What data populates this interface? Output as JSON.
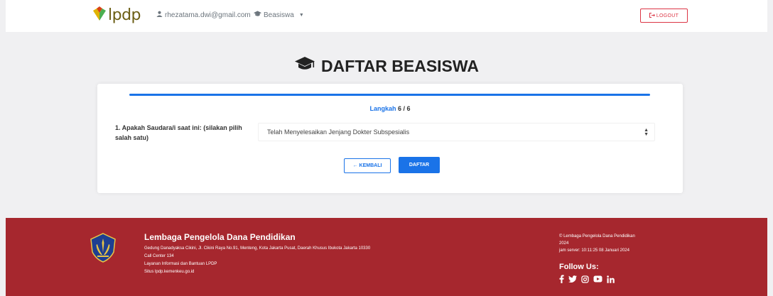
{
  "header": {
    "brand": "lpdp",
    "user_email": "rhezatama.dwi@gmail.com",
    "beasiswa_menu": "Beasiswa",
    "logout_label": "LOGOUT"
  },
  "page": {
    "title": "DAFTAR BEASISWA"
  },
  "form": {
    "step_word": "Langkah",
    "step_value": "6 / 6",
    "question_label": "1. Apakah Saudara/i saat ini: (silakan pilih salah satu)",
    "question_selected": "Telah Menyelesaikan Jenjang Dokter Subspesialis",
    "back_label": "← KEMBALI",
    "submit_label": "DAFTAR"
  },
  "footer": {
    "org_name": "Lembaga Pengelola Dana Pendidikan",
    "address": "Gedung Danadyaksa Cikini, Jl. Cikini Raya No.91, Menteng, Kota Jakarta Pusat, Daerah Khusus Ibukota Jakarta 10330",
    "call_center": "Call Center 134",
    "service": "Layanan Informasi dan Bantuan LPDP",
    "site": "Situs lpdp.kemenkeu.go.id",
    "copyright": "© Lembaga Pengelola Dana Pendidikan",
    "year": "2024",
    "server_time": "jam server: 10:11:25 08 Januari 2024",
    "follow_label": "Follow Us:"
  },
  "colors": {
    "primary": "#1a73e8",
    "footer_bg": "#a6272e",
    "logout": "#dc3545",
    "page_bg": "#f0f0f2"
  },
  "icons": [
    "lpdp-logo-icon",
    "user-icon",
    "graduation-cap-icon",
    "logout-icon",
    "kemenkeu-emblem-icon",
    "facebook-icon",
    "twitter-icon",
    "instagram-icon",
    "youtube-icon",
    "linkedin-icon"
  ]
}
